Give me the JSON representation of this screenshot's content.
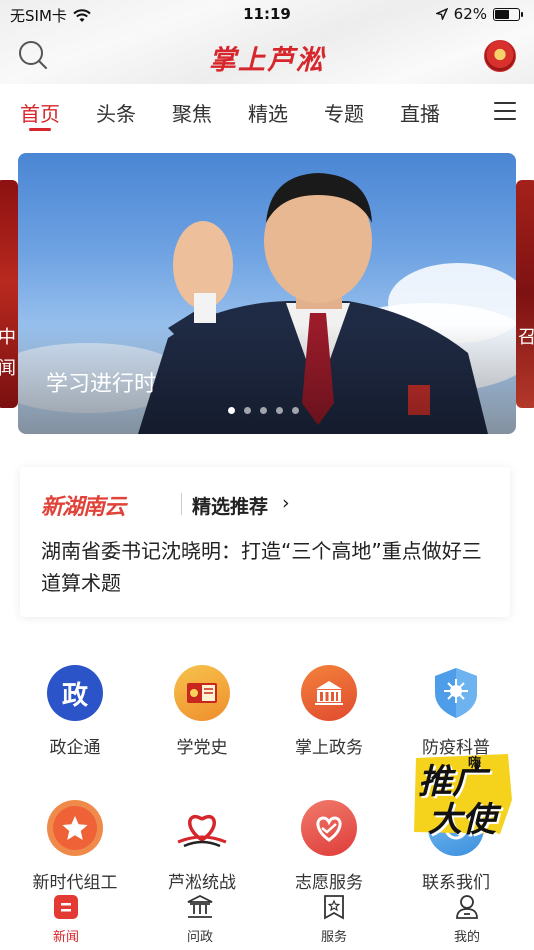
{
  "status_bar": {
    "carrier": "无SIM卡",
    "time": "11:19",
    "battery": "62%",
    "battery_level": 0.62
  },
  "header": {
    "logo": "掌上芦淞"
  },
  "tabs": [
    {
      "label": "首页",
      "active": true
    },
    {
      "label": "头条"
    },
    {
      "label": "聚焦"
    },
    {
      "label": "精选"
    },
    {
      "label": "专题"
    },
    {
      "label": "直播"
    }
  ],
  "side_cards": {
    "left_line1": "中",
    "left_line2": "闻",
    "right_line1": "召"
  },
  "banner": {
    "caption": "学习进行时",
    "slide_count": 5,
    "active_slide": 1
  },
  "recommend": {
    "brand": "新湖南云",
    "label": "精选推荐",
    "headline": "湖南省委书记沈晓明：打造“三个高地”重点做好三道算术题"
  },
  "services": [
    {
      "label": "政企通",
      "icon": "zheng-badge-icon",
      "icon_text": "政"
    },
    {
      "label": "学党史",
      "icon": "party-book-icon"
    },
    {
      "label": "掌上政务",
      "icon": "government-hall-icon"
    },
    {
      "label": "防疫科普",
      "icon": "virus-shield-icon"
    },
    {
      "label": "新时代组工",
      "icon": "star-badge-icon"
    },
    {
      "label": "芦淞统战",
      "icon": "heart-ribbon-icon"
    },
    {
      "label": "志愿服务",
      "icon": "volunteer-heart-icon"
    },
    {
      "label": "联系我们",
      "icon": "contact-icon"
    }
  ],
  "promo": {
    "line1": "推广",
    "line2": "大使",
    "small": "嗨"
  },
  "bottom_nav": [
    {
      "label": "新闻",
      "active": true,
      "icon": "news-icon"
    },
    {
      "label": "问政",
      "icon": "government-icon"
    },
    {
      "label": "服务",
      "icon": "service-flag-icon"
    },
    {
      "label": "我的",
      "icon": "user-icon"
    }
  ],
  "colors": {
    "brand_red": "#d7262b",
    "text": "#222222"
  }
}
